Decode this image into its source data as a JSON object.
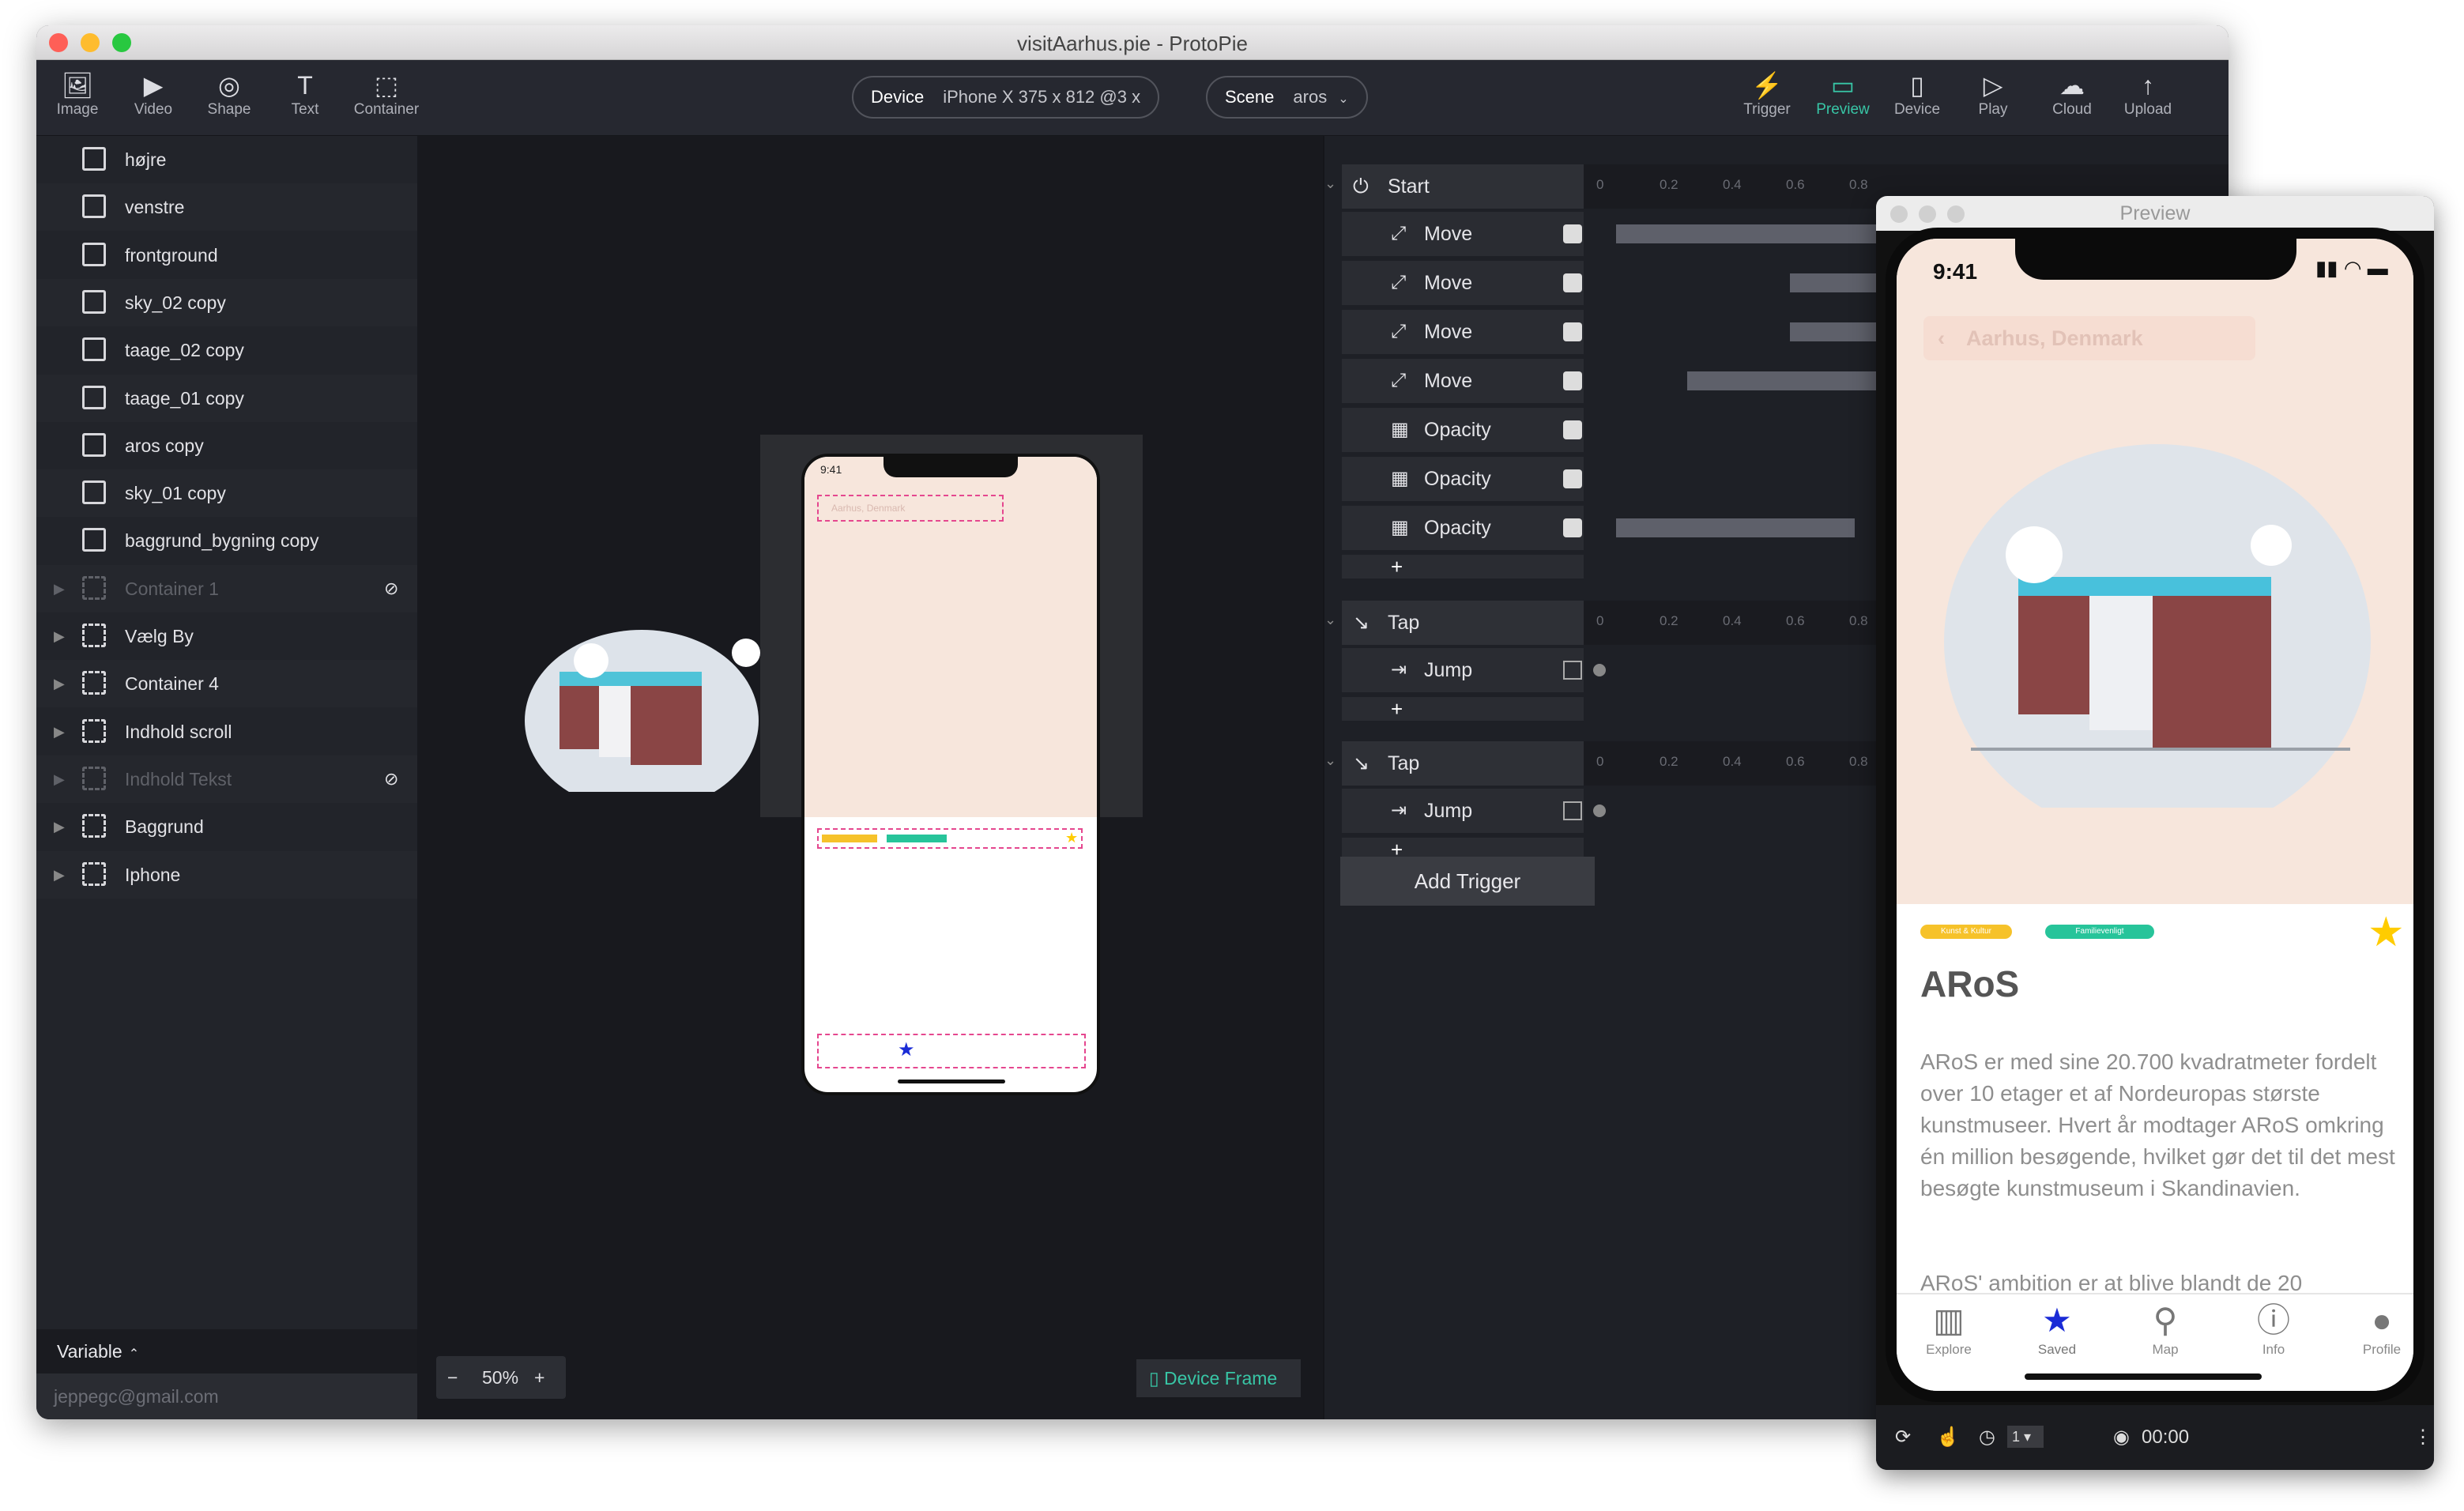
{
  "window": {
    "title": "visitAarhus.pie - ProtoPie"
  },
  "toolbar": {
    "left": [
      {
        "label": "Image",
        "icon": "image-icon"
      },
      {
        "label": "Video",
        "icon": "video-icon"
      },
      {
        "label": "Shape",
        "icon": "shape-icon"
      },
      {
        "label": "Text",
        "icon": "text-icon"
      },
      {
        "label": "Container",
        "icon": "container-icon"
      }
    ],
    "device_label": "Device",
    "device_value": "iPhone X  375 x 812  @3 x",
    "scene_label": "Scene",
    "scene_value": "aros",
    "right": [
      {
        "label": "Trigger",
        "icon": "trigger-icon"
      },
      {
        "label": "Preview",
        "icon": "preview-icon"
      },
      {
        "label": "Device",
        "icon": "device-icon"
      },
      {
        "label": "Play",
        "icon": "play-icon"
      },
      {
        "label": "Cloud",
        "icon": "cloud-icon"
      },
      {
        "label": "Upload",
        "icon": "upload-icon"
      }
    ]
  },
  "layers": [
    {
      "name": "højre",
      "type": "image"
    },
    {
      "name": "venstre",
      "type": "image"
    },
    {
      "name": "frontground",
      "type": "image"
    },
    {
      "name": "sky_02 copy",
      "type": "image"
    },
    {
      "name": "taage_02 copy",
      "type": "image"
    },
    {
      "name": "taage_01 copy",
      "type": "image"
    },
    {
      "name": "aros copy",
      "type": "image"
    },
    {
      "name": "sky_01 copy",
      "type": "image"
    },
    {
      "name": "baggrund_bygning copy",
      "type": "image"
    },
    {
      "name": "Container 1",
      "type": "container",
      "hidden": true
    },
    {
      "name": "Vælg By",
      "type": "container"
    },
    {
      "name": "Container 4",
      "type": "container"
    },
    {
      "name": "Indhold scroll",
      "type": "container"
    },
    {
      "name": "Indhold Tekst",
      "type": "container",
      "hidden": true
    },
    {
      "name": "Baggrund",
      "type": "container"
    },
    {
      "name": "Iphone",
      "type": "container"
    }
  ],
  "variable_label": "Variable",
  "user_email": "jeppegc@gmail.com",
  "canvas": {
    "zoom": "50%",
    "zoom_minus": "−",
    "zoom_plus": "+",
    "device_frame": "Device Frame",
    "artboard_time": "9:41",
    "artboard_header": "Aarhus, Denmark"
  },
  "interactions": [
    {
      "trigger": "Start",
      "icon": "start-icon",
      "responses": [
        "Move",
        "Move",
        "Move",
        "Move",
        "Opacity",
        "Opacity",
        "Opacity"
      ],
      "ticks": [
        "0",
        "0.2",
        "0.4",
        "0.6",
        "0.8"
      ],
      "bars": [
        [
          0.05,
          0.93
        ],
        [
          0.32,
          0.93
        ],
        [
          0.32,
          0.93
        ],
        [
          0.16,
          0.93
        ],
        null,
        null,
        [
          0.05,
          0.42
        ]
      ]
    },
    {
      "trigger": "Tap",
      "icon": "tap-icon",
      "responses": [
        "Jump"
      ],
      "ticks": [
        "0",
        "0.2",
        "0.4",
        "0.6",
        "0.8"
      ],
      "bars": [
        null
      ]
    },
    {
      "trigger": "Tap",
      "icon": "tap-icon",
      "responses": [
        "Jump"
      ],
      "ticks": [
        "0",
        "0.2",
        "0.4",
        "0.6",
        "0.8"
      ],
      "bars": [
        null
      ]
    }
  ],
  "add_trigger": "Add Trigger",
  "add_plus": "+",
  "preview": {
    "title": "Preview",
    "time": "9:41",
    "header": "Aarhus, Denmark",
    "tags": [
      "Kunst & Kultur",
      "Familievenligt"
    ],
    "heading": "ARoS",
    "body": "ARoS er med sine 20.700 kvadratmeter fordelt over 10 etager et af Nordeuropas største kunstmuseer. Hvert år modtager ARoS omkring én million besøgende, hvilket gør det til det mest besøgte kunstmuseum i Skandinavien.",
    "body2": "ARoS' ambition er at blive blandt de 20",
    "tabs": [
      {
        "label": "Explore",
        "icon": "map-book-icon"
      },
      {
        "label": "Saved",
        "icon": "star-icon",
        "active": true
      },
      {
        "label": "Map",
        "icon": "pin-icon"
      },
      {
        "label": "Info",
        "icon": "info-icon"
      },
      {
        "label": "Profile",
        "icon": "profile-icon"
      }
    ],
    "timer": "00:00",
    "dropdown": "1"
  },
  "colors": {
    "accent": "#38c6a6",
    "peach": "#f7e6dc",
    "museum": "#8a4545",
    "tag_yellow": "#f6c22a",
    "tag_green": "#27c49a",
    "star": "#ffcc00",
    "saved": "#1a2bd6"
  }
}
